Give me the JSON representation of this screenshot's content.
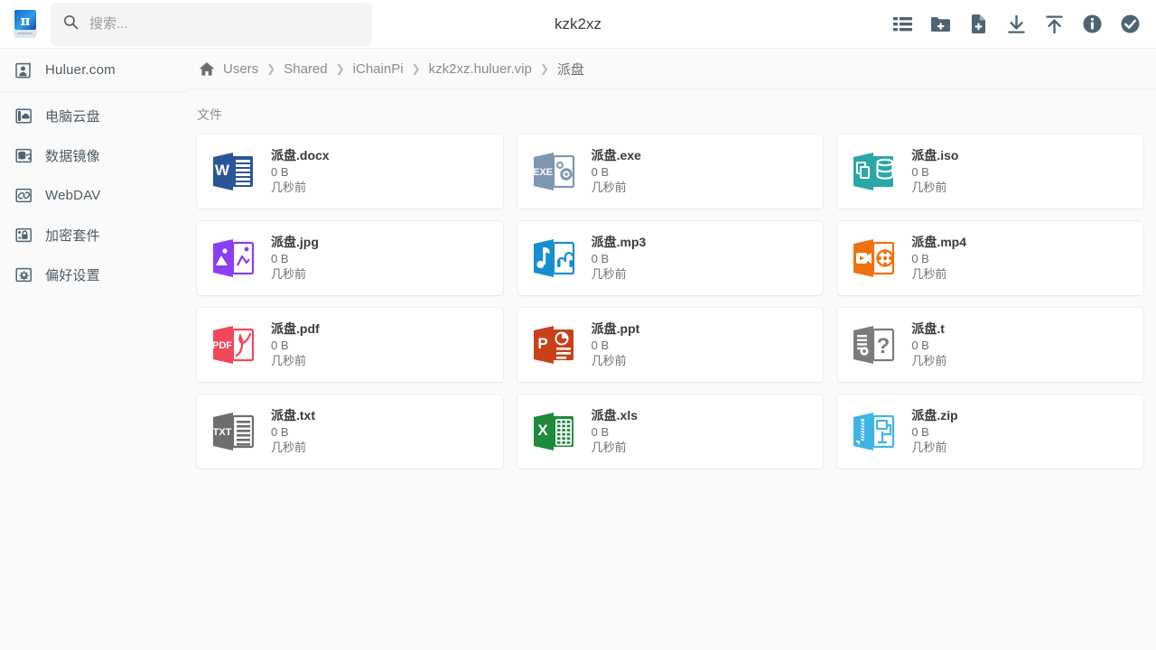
{
  "window": {
    "title": "kzk2xz"
  },
  "logo": {
    "name": "pi-drive-logo",
    "glyph": "π"
  },
  "search": {
    "placeholder": "搜索...",
    "value": "",
    "icon": "search-icon"
  },
  "toolbar": {
    "icons": [
      {
        "name": "list-view-icon",
        "label": "列表视图"
      },
      {
        "name": "new-folder-icon",
        "label": "新建文件夹"
      },
      {
        "name": "new-file-icon",
        "label": "新建文件"
      },
      {
        "name": "download-icon",
        "label": "下载"
      },
      {
        "name": "upload-icon",
        "label": "上传"
      },
      {
        "name": "info-icon",
        "label": "信息"
      },
      {
        "name": "check-circle-icon",
        "label": "选择"
      }
    ]
  },
  "sidebar": {
    "account": {
      "label": "Huluer.com",
      "icon": "user-badge-icon"
    },
    "items": [
      {
        "label": "电脑云盘",
        "icon": "cloud-drive-icon"
      },
      {
        "label": "数据镜像",
        "icon": "database-mirror-icon"
      },
      {
        "label": "WebDAV",
        "icon": "link-square-icon"
      },
      {
        "label": "加密套件",
        "icon": "lock-shield-icon"
      },
      {
        "label": "偏好设置",
        "icon": "gear-icon"
      }
    ]
  },
  "breadcrumb": {
    "home_icon": "home-icon",
    "separator": "❯",
    "crumbs": [
      "Users",
      "Shared",
      "iChainPi",
      "kzk2xz.huluer.vip",
      "派盘"
    ]
  },
  "main": {
    "section_label": "文件",
    "files": [
      {
        "name": "派盘.docx",
        "size": "0 B",
        "time": "几秒前",
        "icon": "word-file-icon",
        "kind": "docx",
        "color": "#2a5699"
      },
      {
        "name": "派盘.exe",
        "size": "0 B",
        "time": "几秒前",
        "icon": "exe-file-icon",
        "kind": "exe",
        "color": "#7e96b0"
      },
      {
        "name": "派盘.iso",
        "size": "0 B",
        "time": "几秒前",
        "icon": "iso-file-icon",
        "kind": "iso",
        "color": "#2aa8a8"
      },
      {
        "name": "派盘.jpg",
        "size": "0 B",
        "time": "几秒前",
        "icon": "image-file-icon",
        "kind": "jpg",
        "color": "#8b3ef5"
      },
      {
        "name": "派盘.mp3",
        "size": "0 B",
        "time": "几秒前",
        "icon": "audio-file-icon",
        "kind": "mp3",
        "color": "#168fd0"
      },
      {
        "name": "派盘.mp4",
        "size": "0 B",
        "time": "几秒前",
        "icon": "video-file-icon",
        "kind": "mp4",
        "color": "#f2700f"
      },
      {
        "name": "派盘.pdf",
        "size": "0 B",
        "time": "几秒前",
        "icon": "pdf-file-icon",
        "kind": "pdf",
        "color": "#f2475b"
      },
      {
        "name": "派盘.ppt",
        "size": "0 B",
        "time": "几秒前",
        "icon": "powerpoint-file-icon",
        "kind": "ppt",
        "color": "#c9401a"
      },
      {
        "name": "派盘.t",
        "size": "0 B",
        "time": "几秒前",
        "icon": "unknown-file-icon",
        "kind": "unknown",
        "color": "#7b7b7b"
      },
      {
        "name": "派盘.txt",
        "size": "0 B",
        "time": "几秒前",
        "icon": "text-file-icon",
        "kind": "txt",
        "color": "#6e6e6e"
      },
      {
        "name": "派盘.xls",
        "size": "0 B",
        "time": "几秒前",
        "icon": "excel-file-icon",
        "kind": "xls",
        "color": "#1d8a3c"
      },
      {
        "name": "派盘.zip",
        "size": "0 B",
        "time": "几秒前",
        "icon": "archive-file-icon",
        "kind": "zip",
        "color": "#40b4e5"
      }
    ]
  },
  "theme": {
    "toolbar_icon_color": "#4f6472",
    "sidebar_text": "#4f5b63",
    "page_bg": "#fafafa",
    "card_bg": "#ffffff"
  }
}
